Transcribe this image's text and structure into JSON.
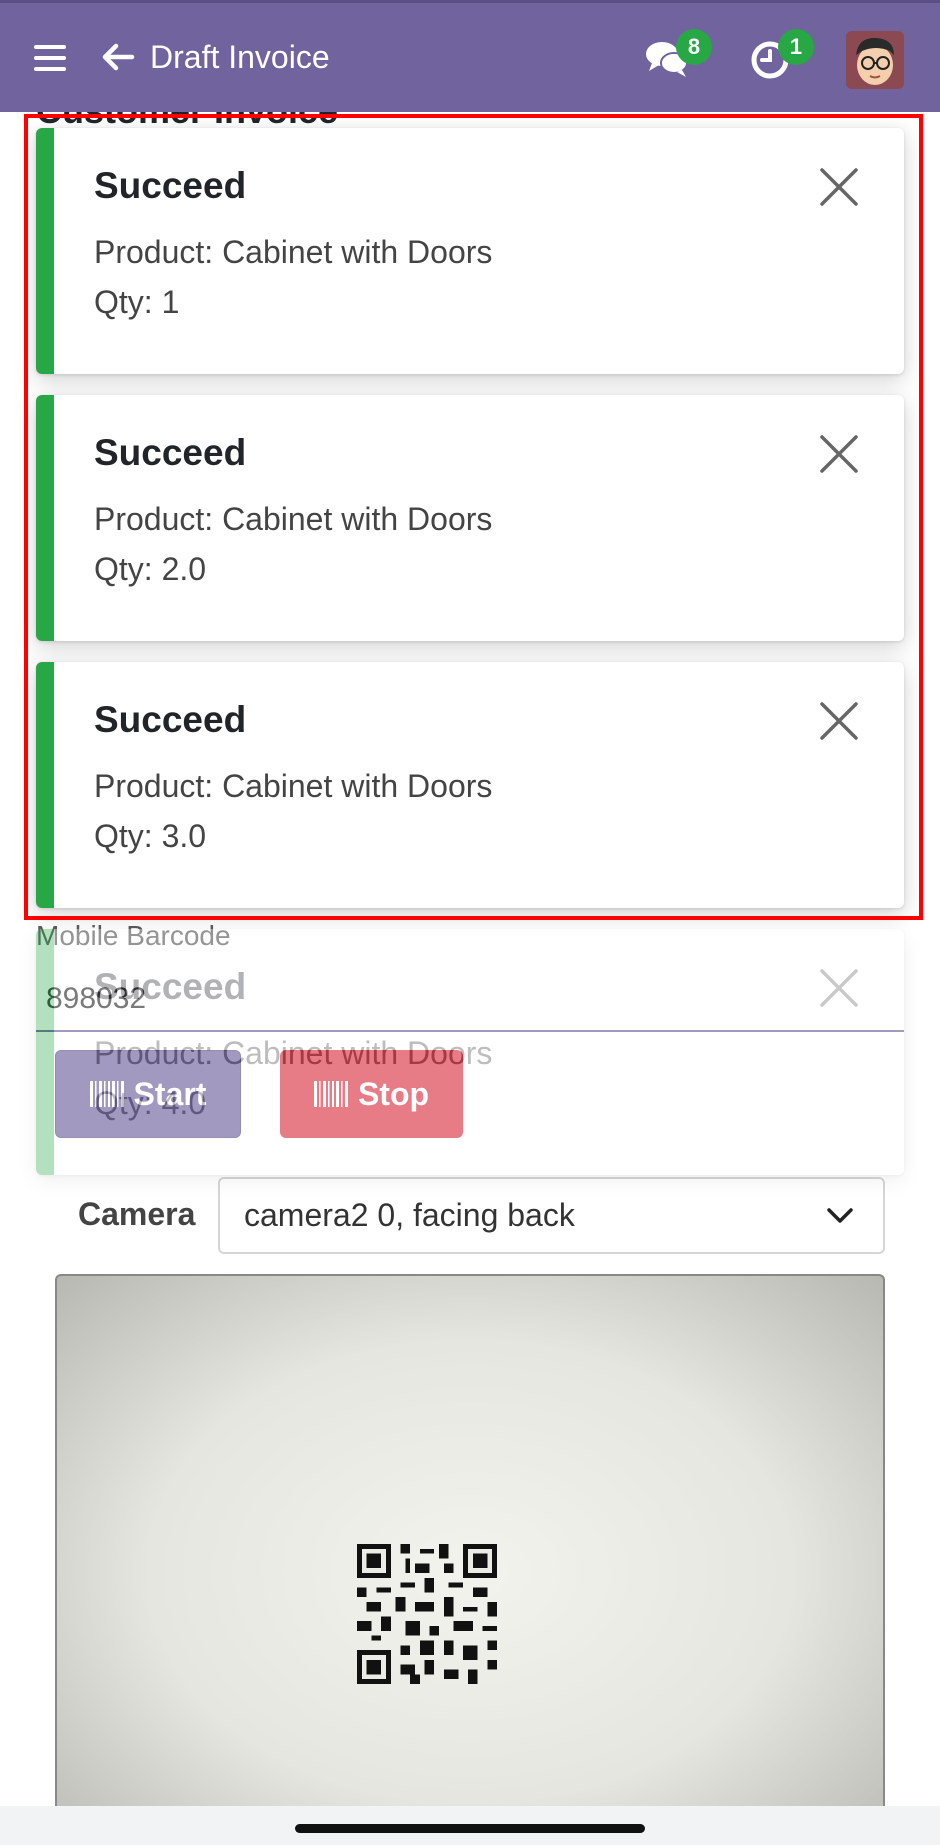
{
  "navbar": {
    "title": "Draft Invoice",
    "messages_count": "8",
    "activities_count": "1",
    "icons": [
      "menu-icon",
      "back-arrow-icon",
      "chat-icon",
      "clock-icon",
      "avatar"
    ],
    "background_color": "#71639e",
    "badge_color": "#28a745"
  },
  "page": {
    "heading_partial": "Customer Invoice",
    "barcode_label": "Mobile Barcode",
    "barcode_value": "898032",
    "start_label": "Start",
    "stop_label": "Stop",
    "camera_label": "Camera",
    "camera_selected": "camera2 0, facing back"
  },
  "notifications": [
    {
      "title": "Succeed",
      "product": "Product: Cabinet with Doors",
      "qty": "Qty: 1"
    },
    {
      "title": "Succeed",
      "product": "Product: Cabinet with Doors",
      "qty": "Qty: 2.0"
    },
    {
      "title": "Succeed",
      "product": "Product: Cabinet with Doors",
      "qty": "Qty: 3.0"
    },
    {
      "title": "Succeed",
      "product": "Product: Cabinet with Doors",
      "qty": "Qty: 4.0"
    }
  ],
  "colors": {
    "success": "#28a745",
    "primary": "#71639e",
    "danger": "#dc3545",
    "highlight_box": "#ff0000"
  }
}
